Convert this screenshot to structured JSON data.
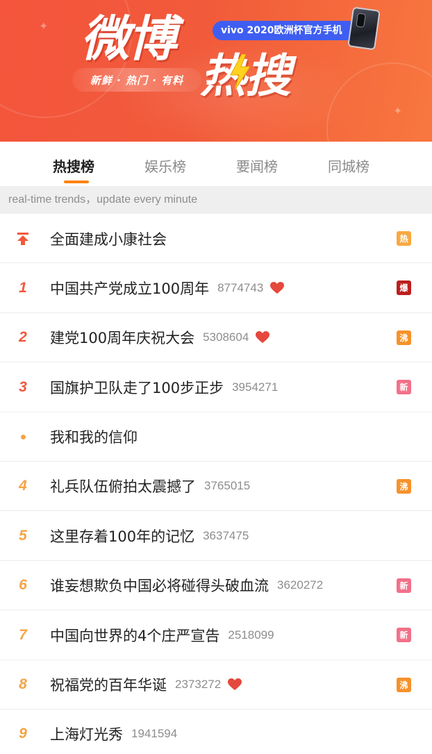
{
  "banner": {
    "title": "微博",
    "title2": "热搜",
    "slogan": "新鲜 · 热门 · 有料",
    "sponsor": "vivo 2020欧洲杯官方手机",
    "bg_color": "#f4553c"
  },
  "tabs": [
    {
      "label": "热搜榜",
      "active": true
    },
    {
      "label": "娱乐榜",
      "active": false
    },
    {
      "label": "要闻榜",
      "active": false
    },
    {
      "label": "同城榜",
      "active": false
    }
  ],
  "notice": "real-time trends，update every minute",
  "badge_colors": {
    "热": "#f7a941",
    "爆": "#bd1e1e",
    "沸": "#f6922b",
    "新": "#f2708a"
  },
  "items": [
    {
      "rank": "",
      "marker": "pin-icon",
      "topic": "全面建成小康社会",
      "count": "",
      "heart": false,
      "badge": "热",
      "badge_color": "#f7a941"
    },
    {
      "rank": "1",
      "marker": "",
      "topic": "中国共产党成立100周年",
      "count": "8774743",
      "heart": true,
      "badge": "爆",
      "badge_color": "#bd1e1e"
    },
    {
      "rank": "2",
      "marker": "",
      "topic": "建党100周年庆祝大会",
      "count": "5308604",
      "heart": true,
      "badge": "沸",
      "badge_color": "#f6922b"
    },
    {
      "rank": "3",
      "marker": "",
      "topic": "国旗护卫队走了100步正步",
      "count": "3954271",
      "heart": false,
      "badge": "新",
      "badge_color": "#f2708a"
    },
    {
      "rank": "",
      "marker": "dot-icon",
      "topic": "我和我的信仰",
      "count": "",
      "heart": false,
      "badge": "",
      "badge_color": ""
    },
    {
      "rank": "4",
      "marker": "",
      "topic": "礼兵队伍俯拍太震撼了",
      "count": "3765015",
      "heart": false,
      "badge": "沸",
      "badge_color": "#f6922b"
    },
    {
      "rank": "5",
      "marker": "",
      "topic": "这里存着100年的记忆",
      "count": "3637475",
      "heart": false,
      "badge": "",
      "badge_color": ""
    },
    {
      "rank": "6",
      "marker": "",
      "topic": "谁妄想欺负中国必将碰得头破血流",
      "count": "3620272",
      "heart": false,
      "badge": "新",
      "badge_color": "#f2708a"
    },
    {
      "rank": "7",
      "marker": "",
      "topic": "中国向世界的4个庄严宣告",
      "count": "2518099",
      "heart": false,
      "badge": "新",
      "badge_color": "#f2708a"
    },
    {
      "rank": "8",
      "marker": "",
      "topic": "祝福党的百年华诞",
      "count": "2373272",
      "heart": true,
      "badge": "沸",
      "badge_color": "#f6922b"
    },
    {
      "rank": "9",
      "marker": "",
      "topic": "上海灯光秀",
      "count": "1941594",
      "heart": false,
      "badge": "",
      "badge_color": ""
    }
  ]
}
